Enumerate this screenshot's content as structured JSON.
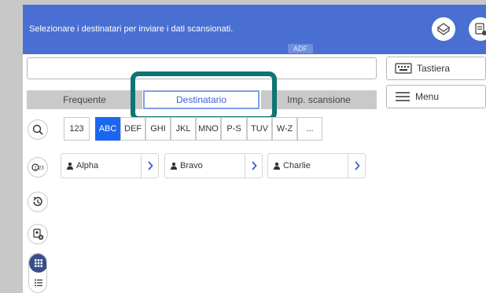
{
  "header": {
    "message": "Selezionare i destinatari per inviare i dati scansionati.",
    "adf_badge": "ADF"
  },
  "keyboard_button": {
    "label": "Tastiera"
  },
  "menu_button": {
    "label": "Menu"
  },
  "tabs": [
    {
      "label": "Frequente",
      "active": false
    },
    {
      "label": "Destinatario",
      "active": true
    },
    {
      "label": "Imp. scansione",
      "active": false
    }
  ],
  "index": [
    "123",
    "ABC",
    "DEF",
    "GHI",
    "JKL",
    "MNO",
    "P-S",
    "TUV",
    "W-Z",
    "..."
  ],
  "index_active": "ABC",
  "side_icons": [
    "search-icon",
    "numeric-search-icon",
    "history-icon",
    "add-contact-icon"
  ],
  "contacts": [
    {
      "name": "Alpha"
    },
    {
      "name": "Bravo"
    },
    {
      "name": "Charlie"
    }
  ],
  "colors": {
    "header": "#4a6fd2",
    "accent_highlight": "#0f7474",
    "active_index": "#1a66f0",
    "active_tab_text": "#3a63d0"
  }
}
